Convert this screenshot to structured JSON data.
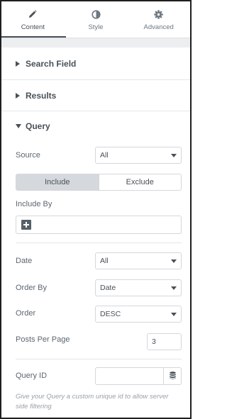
{
  "tabs": [
    {
      "label": "Content",
      "icon": "pencil-icon"
    },
    {
      "label": "Style",
      "icon": "half-circle-icon"
    },
    {
      "label": "Advanced",
      "icon": "gear-icon"
    }
  ],
  "sections": {
    "search_field": "Search Field",
    "results": "Results",
    "query": "Query"
  },
  "query": {
    "source": {
      "label": "Source",
      "value": "All"
    },
    "include_toggle": {
      "include": "Include",
      "exclude": "Exclude",
      "selected": "Include"
    },
    "include_by": {
      "label": "Include By"
    },
    "date": {
      "label": "Date",
      "value": "All"
    },
    "order_by": {
      "label": "Order By",
      "value": "Date"
    },
    "order": {
      "label": "Order",
      "value": "DESC"
    },
    "posts_per_page": {
      "label": "Posts Per Page",
      "value": "3"
    },
    "query_id": {
      "label": "Query ID",
      "value": "",
      "help": "Give your Query a custom unique id to allow server side filtering"
    }
  },
  "colors": {
    "accent": "#495157",
    "border": "#d4d7da",
    "active_segment": "#d5d8dc"
  }
}
